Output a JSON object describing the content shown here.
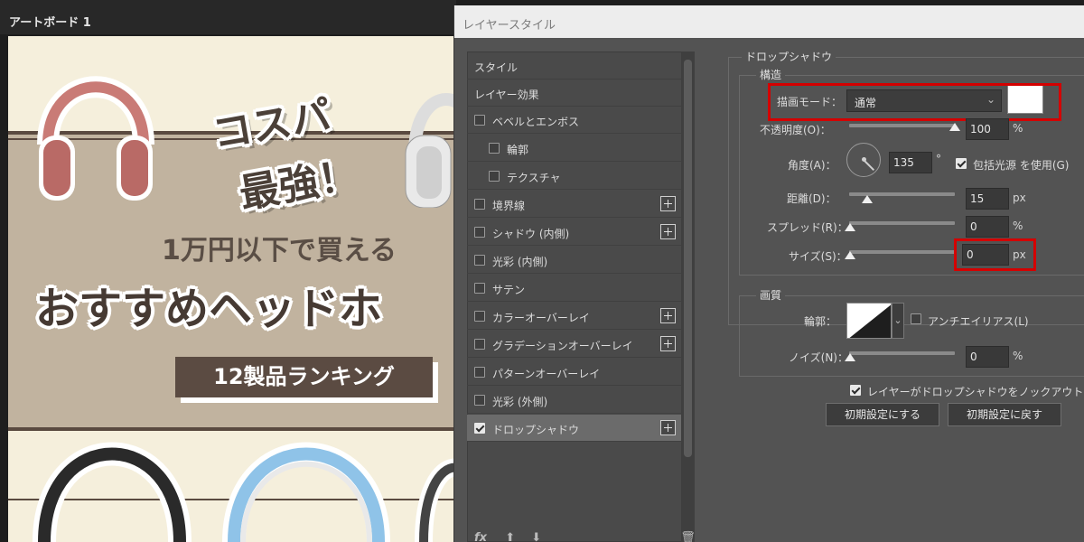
{
  "artboard": {
    "title": "アートボード 1",
    "banner": {
      "catch_line1": "コスパ",
      "catch_line2": "最強！",
      "subline": "1万円以下で買える",
      "mainline": "おすすめヘッドホ",
      "ranking": "12製品ランキング"
    }
  },
  "dialog": {
    "title": "レイヤースタイル",
    "styles_header": "スタイル",
    "effects_header": "レイヤー効果",
    "effects": [
      {
        "label": "ベベルとエンボス",
        "checked": false,
        "plus": false,
        "indent": 0
      },
      {
        "label": "輪郭",
        "checked": false,
        "plus": false,
        "indent": 1
      },
      {
        "label": "テクスチャ",
        "checked": false,
        "plus": false,
        "indent": 1
      },
      {
        "label": "境界線",
        "checked": false,
        "plus": true,
        "indent": 0
      },
      {
        "label": "シャドウ (内側)",
        "checked": false,
        "plus": true,
        "indent": 0
      },
      {
        "label": "光彩 (内側)",
        "checked": false,
        "plus": false,
        "indent": 0
      },
      {
        "label": "サテン",
        "checked": false,
        "plus": false,
        "indent": 0
      },
      {
        "label": "カラーオーバーレイ",
        "checked": false,
        "plus": true,
        "indent": 0
      },
      {
        "label": "グラデーションオーバーレイ",
        "checked": false,
        "plus": true,
        "indent": 0
      },
      {
        "label": "パターンオーバーレイ",
        "checked": false,
        "plus": false,
        "indent": 0
      },
      {
        "label": "光彩 (外側)",
        "checked": false,
        "plus": false,
        "indent": 0
      },
      {
        "label": "ドロップシャドウ",
        "checked": true,
        "plus": true,
        "indent": 0,
        "selected": true
      }
    ],
    "bottom_icons": {
      "fx": "fx",
      "up": "⬆",
      "down": "⬇",
      "trash": "🗑"
    },
    "drop_shadow": {
      "section": "ドロップシャドウ",
      "structure": {
        "title": "構造",
        "blend_mode_label": "描画モード：",
        "blend_mode_value": "通常",
        "shadow_color": "#ffffff",
        "opacity_label": "不透明度(O)：",
        "opacity_value": "100",
        "opacity_unit": "%",
        "opacity_level": 1.0,
        "angle_label": "角度(A)：",
        "angle_value": "135",
        "angle_unit": "°",
        "global_light_label": "包括光源 を使用(G)",
        "global_light_checked": true,
        "distance_label": "距離(D)：",
        "distance_value": "15",
        "distance_unit": "px",
        "distance_level": 0.15,
        "spread_label": "スプレッド(R)：",
        "spread_value": "0",
        "spread_unit": "%",
        "size_label": "サイズ(S)：",
        "size_value": "0",
        "size_unit": "px"
      },
      "quality": {
        "title": "画質",
        "contour_label": "輪郭：",
        "antialias_label": "アンチエイリアス(L)",
        "antialias_checked": false,
        "noise_label": "ノイズ(N)：",
        "noise_value": "0",
        "noise_unit": "%"
      },
      "knockout_label": "レイヤーがドロップシャドウをノックアウト(U)",
      "knockout_checked": true,
      "make_default_label": "初期設定にする",
      "reset_default_label": "初期設定に戻す"
    },
    "highlight_color": "#d40000"
  }
}
